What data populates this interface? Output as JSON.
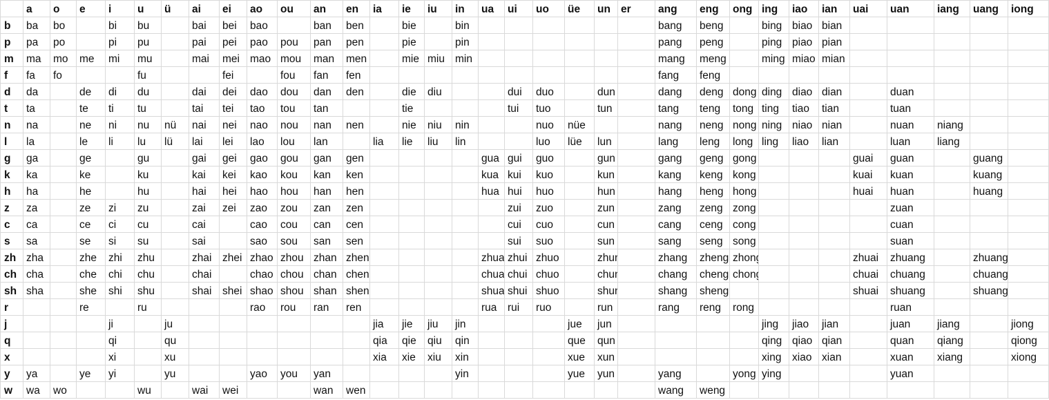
{
  "finals": [
    "a",
    "o",
    "e",
    "i",
    "u",
    "ü",
    "ai",
    "ei",
    "ao",
    "ou",
    "an",
    "en",
    "ia",
    "ie",
    "iu",
    "in",
    "ua",
    "ui",
    "uo",
    "üe",
    "un",
    "er",
    "ang",
    "eng",
    "ong",
    "ing",
    "iao",
    "ian",
    "uai",
    "uan",
    "iang",
    "uang",
    "iong"
  ],
  "rows": [
    {
      "initial": "b",
      "cells": [
        "ba",
        "bo",
        "",
        "bi",
        "bu",
        "",
        "bai",
        "bei",
        "bao",
        "",
        "ban",
        "ben",
        "",
        "bie",
        "",
        "bin",
        "",
        "",
        "",
        "",
        "",
        "",
        "bang",
        "beng",
        "",
        "bing",
        "biao",
        "bian",
        "",
        "",
        "",
        "",
        ""
      ]
    },
    {
      "initial": "p",
      "cells": [
        "pa",
        "po",
        "",
        "pi",
        "pu",
        "",
        "pai",
        "pei",
        "pao",
        "pou",
        "pan",
        "pen",
        "",
        "pie",
        "",
        "pin",
        "",
        "",
        "",
        "",
        "",
        "",
        "pang",
        "peng",
        "",
        "ping",
        "piao",
        "pian",
        "",
        "",
        "",
        "",
        ""
      ]
    },
    {
      "initial": "m",
      "cells": [
        "ma",
        "mo",
        "me",
        "mi",
        "mu",
        "",
        "mai",
        "mei",
        "mao",
        "mou",
        "man",
        "men",
        "",
        "mie",
        "miu",
        "min",
        "",
        "",
        "",
        "",
        "",
        "",
        "mang",
        "meng",
        "",
        "ming",
        "miao",
        "mian",
        "",
        "",
        "",
        "",
        ""
      ]
    },
    {
      "initial": "f",
      "cells": [
        "fa",
        "fo",
        "",
        "",
        "fu",
        "",
        "",
        "fei",
        "",
        "fou",
        "fan",
        "fen",
        "",
        "",
        "",
        "",
        "",
        "",
        "",
        "",
        "",
        "",
        "fang",
        "feng",
        "",
        "",
        "",
        "",
        "",
        "",
        "",
        "",
        ""
      ]
    },
    {
      "initial": "d",
      "cells": [
        "da",
        "",
        "de",
        "di",
        "du",
        "",
        "dai",
        "dei",
        "dao",
        "dou",
        "dan",
        "den",
        "",
        "die",
        "diu",
        "",
        "",
        "dui",
        "duo",
        "",
        "dun",
        "",
        "dang",
        "deng",
        "dong",
        "ding",
        "diao",
        "dian",
        "",
        "duan",
        "",
        "",
        ""
      ]
    },
    {
      "initial": "t",
      "cells": [
        "ta",
        "",
        "te",
        "ti",
        "tu",
        "",
        "tai",
        "tei",
        "tao",
        "tou",
        "tan",
        "",
        "",
        "tie",
        "",
        "",
        "",
        "tui",
        "tuo",
        "",
        "tun",
        "",
        "tang",
        "teng",
        "tong",
        "ting",
        "tiao",
        "tian",
        "",
        "tuan",
        "",
        "",
        ""
      ]
    },
    {
      "initial": "n",
      "cells": [
        "na",
        "",
        "ne",
        "ni",
        "nu",
        "nü",
        "nai",
        "nei",
        "nao",
        "nou",
        "nan",
        "nen",
        "",
        "nie",
        "niu",
        "nin",
        "",
        "",
        "nuo",
        "nüe",
        "",
        "",
        "nang",
        "neng",
        "nong",
        "ning",
        "niao",
        "nian",
        "",
        "nuan",
        "niang",
        "",
        ""
      ]
    },
    {
      "initial": "l",
      "cells": [
        "la",
        "",
        "le",
        "li",
        "lu",
        "lü",
        "lai",
        "lei",
        "lao",
        "lou",
        "lan",
        "",
        "lia",
        "lie",
        "liu",
        "lin",
        "",
        "",
        "luo",
        "lüe",
        "lun",
        "",
        "lang",
        "leng",
        "long",
        "ling",
        "liao",
        "lian",
        "",
        "luan",
        "liang",
        "",
        ""
      ]
    },
    {
      "initial": "g",
      "cells": [
        "ga",
        "",
        "ge",
        "",
        "gu",
        "",
        "gai",
        "gei",
        "gao",
        "gou",
        "gan",
        "gen",
        "",
        "",
        "",
        "",
        "gua",
        "gui",
        "guo",
        "",
        "gun",
        "",
        "gang",
        "geng",
        "gong",
        "",
        "",
        "",
        "guai",
        "guan",
        "",
        "guang",
        ""
      ]
    },
    {
      "initial": "k",
      "cells": [
        "ka",
        "",
        "ke",
        "",
        "ku",
        "",
        "kai",
        "kei",
        "kao",
        "kou",
        "kan",
        "ken",
        "",
        "",
        "",
        "",
        "kua",
        "kui",
        "kuo",
        "",
        "kun",
        "",
        "kang",
        "keng",
        "kong",
        "",
        "",
        "",
        "kuai",
        "kuan",
        "",
        "kuang",
        ""
      ]
    },
    {
      "initial": "h",
      "cells": [
        "ha",
        "",
        "he",
        "",
        "hu",
        "",
        "hai",
        "hei",
        "hao",
        "hou",
        "han",
        "hen",
        "",
        "",
        "",
        "",
        "hua",
        "hui",
        "huo",
        "",
        "hun",
        "",
        "hang",
        "heng",
        "hong",
        "",
        "",
        "",
        "huai",
        "huan",
        "",
        "huang",
        ""
      ]
    },
    {
      "initial": "z",
      "cells": [
        "za",
        "",
        "ze",
        "zi",
        "zu",
        "",
        "zai",
        "zei",
        "zao",
        "zou",
        "zan",
        "zen",
        "",
        "",
        "",
        "",
        "",
        "zui",
        "zuo",
        "",
        "zun",
        "",
        "zang",
        "zeng",
        "zong",
        "",
        "",
        "",
        "",
        "zuan",
        "",
        "",
        ""
      ]
    },
    {
      "initial": "c",
      "cells": [
        "ca",
        "",
        "ce",
        "ci",
        "cu",
        "",
        "cai",
        "",
        "cao",
        "cou",
        "can",
        "cen",
        "",
        "",
        "",
        "",
        "",
        "cui",
        "cuo",
        "",
        "cun",
        "",
        "cang",
        "ceng",
        "cong",
        "",
        "",
        "",
        "",
        "cuan",
        "",
        "",
        ""
      ]
    },
    {
      "initial": "s",
      "cells": [
        "sa",
        "",
        "se",
        "si",
        "su",
        "",
        "sai",
        "",
        "sao",
        "sou",
        "san",
        "sen",
        "",
        "",
        "",
        "",
        "",
        "sui",
        "suo",
        "",
        "sun",
        "",
        "sang",
        "seng",
        "song",
        "",
        "",
        "",
        "",
        "suan",
        "",
        "",
        ""
      ]
    },
    {
      "initial": "zh",
      "cells": [
        "zha",
        "",
        "zhe",
        "zhi",
        "zhu",
        "",
        "zhai",
        "zhei",
        "zhao",
        "zhou",
        "zhan",
        "zhen",
        "",
        "",
        "",
        "",
        "zhua",
        "zhui",
        "zhuo",
        "",
        "zhun",
        "",
        "zhang",
        "zheng",
        "zhong",
        "",
        "",
        "",
        "zhuai",
        "zhuang",
        "",
        "zhuang",
        ""
      ]
    },
    {
      "initial": "ch",
      "cells": [
        "cha",
        "",
        "che",
        "chi",
        "chu",
        "",
        "chai",
        "",
        "chao",
        "chou",
        "chan",
        "chen",
        "",
        "",
        "",
        "",
        "chua",
        "chui",
        "chuo",
        "",
        "chun",
        "",
        "chang",
        "cheng",
        "chong",
        "",
        "",
        "",
        "chuai",
        "chuang",
        "",
        "chuang",
        ""
      ]
    },
    {
      "initial": "sh",
      "cells": [
        "sha",
        "",
        "she",
        "shi",
        "shu",
        "",
        "shai",
        "shei",
        "shao",
        "shou",
        "shan",
        "shen",
        "",
        "",
        "",
        "",
        "shua",
        "shui",
        "shuo",
        "",
        "shun",
        "",
        "shang",
        "sheng",
        "",
        "",
        "",
        "",
        "shuai",
        "shuang",
        "",
        "shuang",
        ""
      ]
    },
    {
      "initial": "r",
      "cells": [
        "",
        "",
        "re",
        "",
        "ru",
        "",
        "",
        "",
        "rao",
        "rou",
        "ran",
        "ren",
        "",
        "",
        "",
        "",
        "rua",
        "rui",
        "ruo",
        "",
        "run",
        "",
        "rang",
        "reng",
        "rong",
        "",
        "",
        "",
        "",
        "ruan",
        "",
        "",
        ""
      ]
    },
    {
      "initial": "j",
      "cells": [
        "",
        "",
        "",
        "ji",
        "",
        "ju",
        "",
        "",
        "",
        "",
        "",
        "",
        "jia",
        "jie",
        "jiu",
        "jin",
        "",
        "",
        "",
        "jue",
        "jun",
        "",
        "",
        "",
        "",
        "jing",
        "jiao",
        "jian",
        "",
        "juan",
        "jiang",
        "",
        "jiong"
      ]
    },
    {
      "initial": "q",
      "cells": [
        "",
        "",
        "",
        "qi",
        "",
        "qu",
        "",
        "",
        "",
        "",
        "",
        "",
        "qia",
        "qie",
        "qiu",
        "qin",
        "",
        "",
        "",
        "que",
        "qun",
        "",
        "",
        "",
        "",
        "qing",
        "qiao",
        "qian",
        "",
        "quan",
        "qiang",
        "",
        "qiong"
      ]
    },
    {
      "initial": "x",
      "cells": [
        "",
        "",
        "",
        "xi",
        "",
        "xu",
        "",
        "",
        "",
        "",
        "",
        "",
        "xia",
        "xie",
        "xiu",
        "xin",
        "",
        "",
        "",
        "xue",
        "xun",
        "",
        "",
        "",
        "",
        "xing",
        "xiao",
        "xian",
        "",
        "xuan",
        "xiang",
        "",
        "xiong"
      ]
    },
    {
      "initial": "y",
      "cells": [
        "ya",
        "",
        "ye",
        "yi",
        "",
        "yu",
        "",
        "",
        "yao",
        "you",
        "yan",
        "",
        "",
        "",
        "",
        "yin",
        "",
        "",
        "",
        "yue",
        "yun",
        "",
        "yang",
        "",
        "yong",
        "ying",
        "",
        "",
        "",
        "yuan",
        "",
        "",
        ""
      ]
    },
    {
      "initial": "w",
      "cells": [
        "wa",
        "wo",
        "",
        "",
        "wu",
        "",
        "wai",
        "wei",
        "",
        "",
        "wan",
        "wen",
        "",
        "",
        "",
        "",
        "",
        "",
        "",
        "",
        "",
        "",
        "wang",
        "weng",
        "",
        "",
        "",
        "",
        "",
        "",
        "",
        "",
        ""
      ]
    }
  ]
}
